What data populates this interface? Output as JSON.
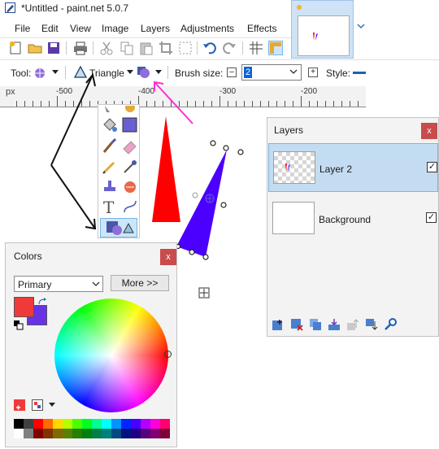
{
  "window": {
    "title": "*Untitled - paint.net 5.0.7"
  },
  "menu": [
    "File",
    "Edit",
    "View",
    "Image",
    "Layers",
    "Adjustments",
    "Effects"
  ],
  "tool_options": {
    "tool_label": "Tool:",
    "shape_label": "Triangle",
    "brush_label": "Brush size:",
    "brush_value": "2",
    "style_label": "Style:"
  },
  "ruler": {
    "unit": "px",
    "ticks": [
      "-500",
      "-400",
      "-300",
      "-200"
    ]
  },
  "colors_window": {
    "title": "Colors",
    "close": "x",
    "mode": "Primary",
    "more_button": "More >>",
    "primary_color": "#f03a3a",
    "secondary_color": "#6a32e6"
  },
  "layers_window": {
    "title": "Layers",
    "close": "x",
    "layers": [
      {
        "name": "Layer 2",
        "visible": true,
        "selected": true
      },
      {
        "name": "Background",
        "visible": true,
        "selected": false
      }
    ],
    "check_glyph": "✓"
  },
  "palette": [
    "#000000",
    "#404040",
    "#ff0000",
    "#ff6a00",
    "#ffd800",
    "#b6ff00",
    "#4cff00",
    "#00ff21",
    "#00ff90",
    "#00ffff",
    "#0094ff",
    "#0026ff",
    "#4800ff",
    "#b200ff",
    "#ff00dc",
    "#ff006e",
    "#ffffff",
    "#808080",
    "#7f0000",
    "#7f3300",
    "#7f6a00",
    "#5b7f00",
    "#267f00",
    "#007f0e",
    "#007f46",
    "#007f7f",
    "#004a7f",
    "#00137f",
    "#21007f",
    "#57007f",
    "#7f006e",
    "#7f0037"
  ],
  "accent_colors": {
    "red_triangle": "#ff0000",
    "blue_triangle": "#4b00ff",
    "annotation_arrow": "#ff2fd5"
  },
  "icons": [
    "app-icon",
    "new-icon",
    "open-icon",
    "save-icon",
    "print-icon",
    "cut-icon",
    "copy-icon",
    "paste-icon",
    "crop-icon",
    "deselect-icon",
    "undo-icon",
    "redo-icon",
    "grid-icon",
    "ruler-icon",
    "move-icon",
    "recolor-icon",
    "paint-bucket-icon",
    "gradient-icon",
    "paintbrush-icon",
    "eraser-icon",
    "pencil-icon",
    "color-picker-icon",
    "clone-stamp-icon",
    "text-icon",
    "line-curve-icon",
    "shapes-icon",
    "add-layer-icon",
    "delete-layer-icon",
    "duplicate-layer-icon",
    "merge-layer-down-icon",
    "move-layer-up-icon",
    "move-layer-down-icon",
    "layer-properties-icon"
  ]
}
